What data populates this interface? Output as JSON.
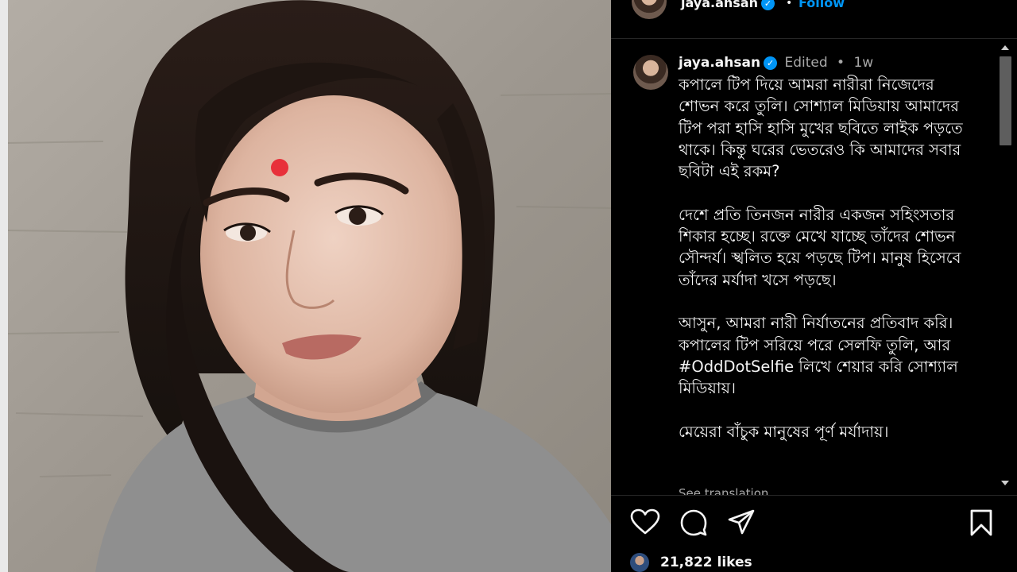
{
  "post": {
    "username": "jaya.ahsan",
    "verified_mark": "✓",
    "header_separator": "•",
    "follow_label": "Follow",
    "more_label": "•••",
    "edited_label": "Edited",
    "meta_separator": "•",
    "time_ago": "1w",
    "caption_paragraphs": [
      "কপালে টিপ দিয়ে আমরা নারীরা নিজেদের শোভন করে তুলি। সোশ্যাল মিডিয়ায় আমাদের টিপ পরা হাসি হাসি মুখের ছবিতে লাইক পড়তে থাকে। কিন্তু ঘরের ভেতরেও কি আমাদের সবার ছবিটা এই রকম?",
      "দেশে প্রতি তিনজন নারীর একজন সহিংসতার শিকার হচ্ছে। রক্তে মেখে যাচ্ছে তাঁদের শোভন সৌন্দর্য। স্খলিত হয়ে পড়ছে টিপ। মানুষ হিসেবে তাঁদের মর্যাদা খসে পড়ছে।",
      "আসুন, আমরা নারী নির্যাতনের প্রতিবাদ করি। কপালের টিপ সরিয়ে পরে সেলফি তুলি, আর #OddDotSelfie লিখে শেয়ার করি সোশ্যাল মিডিয়ায়।",
      "মেয়েরা বাঁচুক মানুষের পূর্ণ মর্যাদায়।"
    ],
    "see_translation": "See translation",
    "likes": "21,822 likes"
  },
  "icons": {
    "like": "heart-icon",
    "comment": "comment-icon",
    "share": "share-icon",
    "save": "bookmark-icon",
    "more": "more-icon",
    "verified": "verified-badge-icon"
  },
  "colors": {
    "panel_bg": "#000000",
    "text": "#f5f5f5",
    "muted": "#a8a8a8",
    "link_blue": "#0095f6",
    "bindi_red": "#e8303a"
  }
}
